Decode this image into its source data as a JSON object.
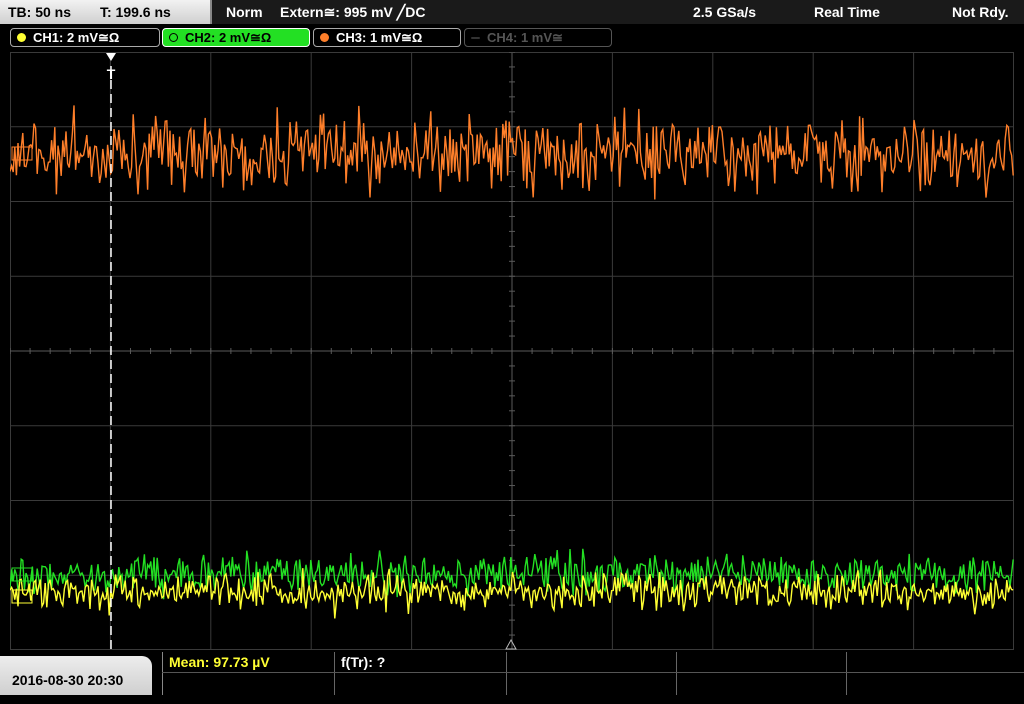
{
  "header": {
    "timebase": "TB: 50 ns",
    "trigger_time": "T: 199.6 ns",
    "trigger_mode": "Norm",
    "trigger_source": "Extern≅: 995 mV ╱DC",
    "sample_rate": "2.5 GSa/s",
    "acq_mode": "Real Time",
    "ready_status": "Not Rdy."
  },
  "channels": [
    {
      "label": "CH1: 2 mV≅Ω",
      "color": "#ffff33",
      "state": "on"
    },
    {
      "label": "CH2: 2 mV≅Ω",
      "color": "#23e023",
      "state": "active"
    },
    {
      "label": "CH3: 1 mV≅Ω",
      "color": "#ff7f2a",
      "state": "on"
    },
    {
      "label": "CH4: 1 mV≅",
      "color": "#555555",
      "state": "off"
    }
  ],
  "trigger_marker": "T",
  "footer": {
    "datetime": "2016-08-30 20:30",
    "measurement_mean": "Mean: 97.73 µV",
    "measurement_freq": "f(Tr): ?"
  }
}
